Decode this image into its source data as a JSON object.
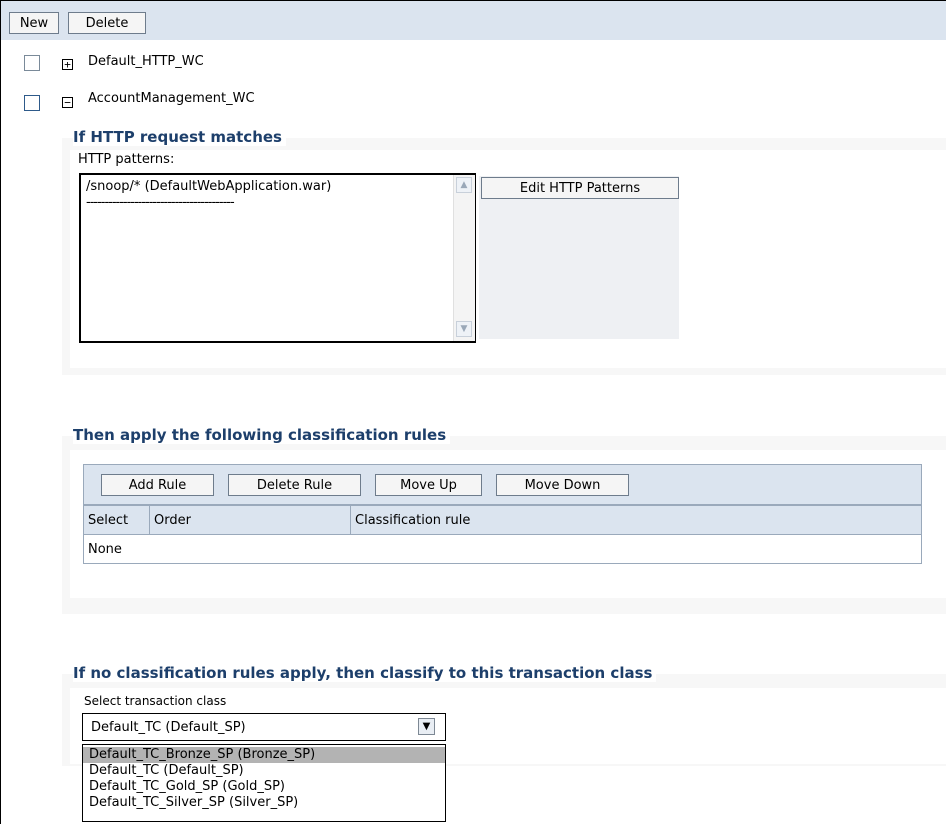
{
  "toolbar": {
    "new_label": "New",
    "delete_label": "Delete"
  },
  "tree": {
    "item1": "Default_HTTP_WC",
    "item2": "AccountManagement_WC",
    "item1_expander": "+",
    "item2_expander": "−"
  },
  "http_section": {
    "legend": "If HTTP request matches",
    "patterns_label": "HTTP patterns:",
    "patterns": [
      "/snoop/* (DefaultWebApplication.war)",
      "----------------------------------------"
    ],
    "edit_button": "Edit HTTP Patterns"
  },
  "rules_section": {
    "legend": "Then apply the following classification rules",
    "add_rule": "Add Rule",
    "delete_rule": "Delete Rule",
    "move_up": "Move Up",
    "move_down": "Move Down",
    "columns": [
      "Select",
      "Order",
      "Classification rule"
    ],
    "empty_text": "None"
  },
  "tc_section": {
    "legend": "If no classification rules apply, then classify to this transaction class",
    "select_label": "Select transaction class",
    "selected_value": "Default_TC (Default_SP)",
    "options": [
      "Default_TC_Bronze_SP (Bronze_SP)",
      "Default_TC (Default_SP)",
      "Default_TC_Gold_SP (Gold_SP)",
      "Default_TC_Silver_SP (Silver_SP)"
    ]
  }
}
